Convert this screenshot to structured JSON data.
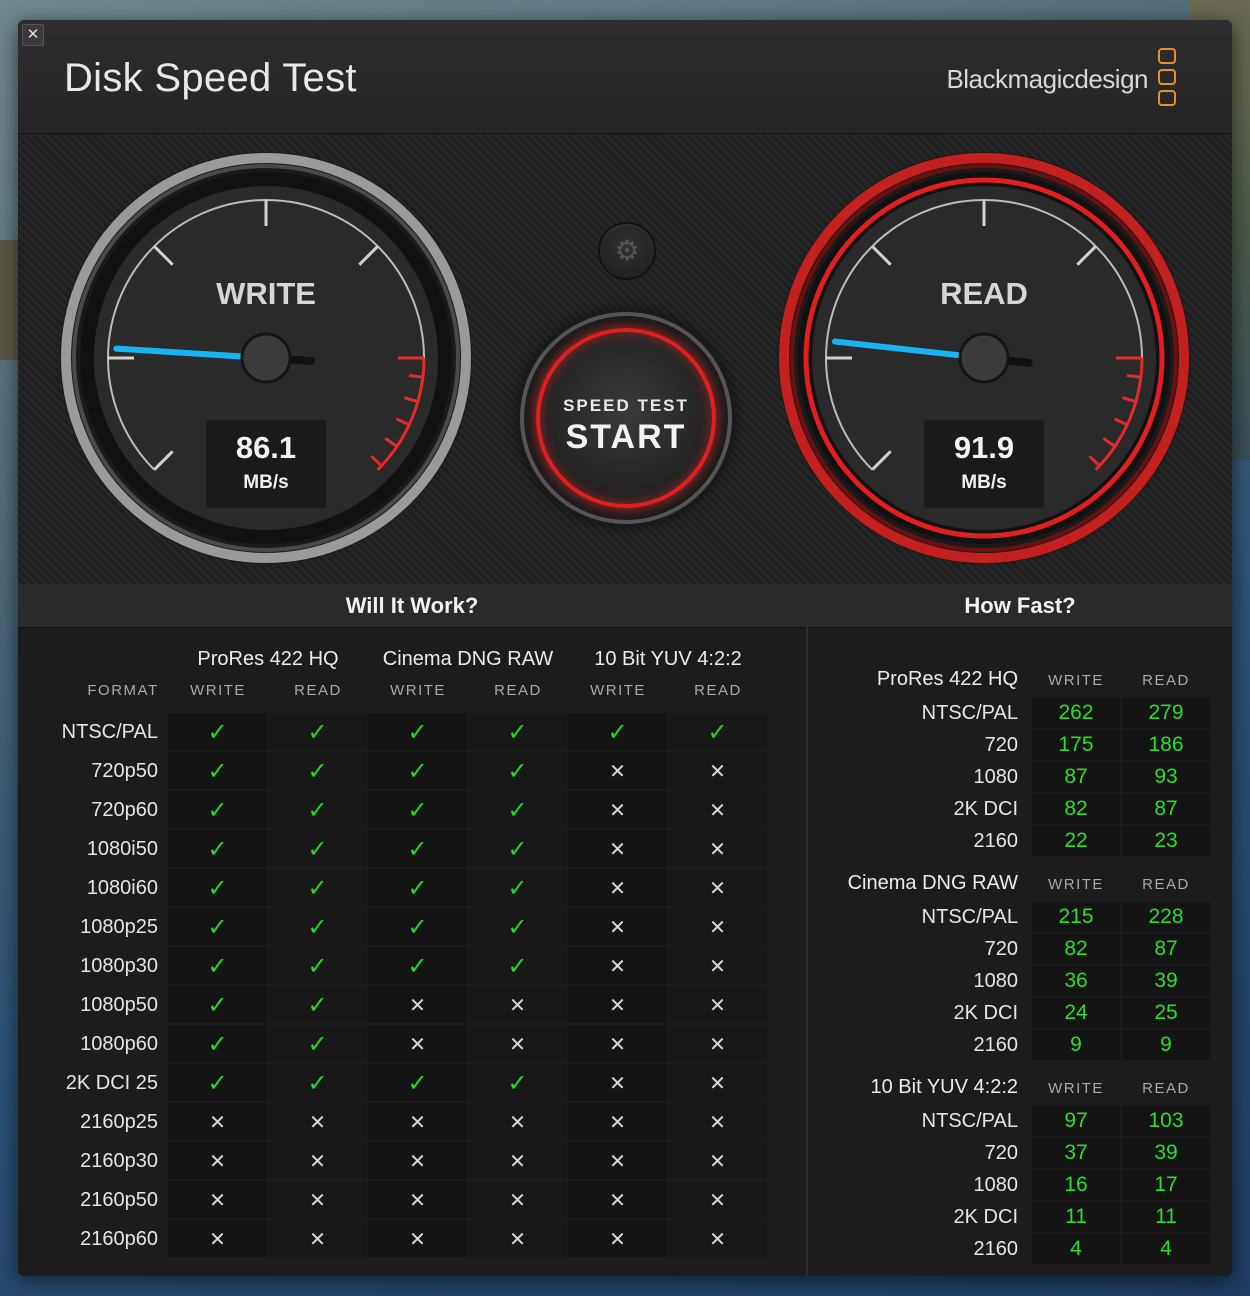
{
  "app": {
    "title": "Disk Speed Test",
    "brand": "Blackmagicdesign",
    "close_glyph": "✕",
    "accent_color": "#e11f1f",
    "ok_color": "#26d626"
  },
  "gauges": {
    "write": {
      "label": "WRITE",
      "value": "86.1",
      "unit": "MB/s",
      "fraction": 0.18
    },
    "read": {
      "label": "READ",
      "value": "91.9",
      "unit": "MB/s",
      "fraction": 0.19
    }
  },
  "controls": {
    "settings_icon": "gear-icon",
    "settings_glyph": "⚙",
    "start_small": "SPEED TEST",
    "start_big": "START"
  },
  "will_it_work": {
    "title": "Will It Work?",
    "format_label": "FORMAT",
    "groups": [
      {
        "name": "ProRes 422 HQ",
        "cols": [
          "WRITE",
          "READ"
        ]
      },
      {
        "name": "Cinema DNG RAW",
        "cols": [
          "WRITE",
          "READ"
        ]
      },
      {
        "name": "10 Bit YUV 4:2:2",
        "cols": [
          "WRITE",
          "READ"
        ]
      }
    ],
    "ok_glyph": "✓",
    "no_glyph": "✕",
    "rows": [
      {
        "format": "NTSC/PAL",
        "results": [
          1,
          1,
          1,
          1,
          1,
          1
        ]
      },
      {
        "format": "720p50",
        "results": [
          1,
          1,
          1,
          1,
          0,
          0
        ]
      },
      {
        "format": "720p60",
        "results": [
          1,
          1,
          1,
          1,
          0,
          0
        ]
      },
      {
        "format": "1080i50",
        "results": [
          1,
          1,
          1,
          1,
          0,
          0
        ]
      },
      {
        "format": "1080i60",
        "results": [
          1,
          1,
          1,
          1,
          0,
          0
        ]
      },
      {
        "format": "1080p25",
        "results": [
          1,
          1,
          1,
          1,
          0,
          0
        ]
      },
      {
        "format": "1080p30",
        "results": [
          1,
          1,
          1,
          1,
          0,
          0
        ]
      },
      {
        "format": "1080p50",
        "results": [
          1,
          1,
          0,
          0,
          0,
          0
        ]
      },
      {
        "format": "1080p60",
        "results": [
          1,
          1,
          0,
          0,
          0,
          0
        ]
      },
      {
        "format": "2K DCI 25",
        "results": [
          1,
          1,
          1,
          1,
          0,
          0
        ]
      },
      {
        "format": "2160p25",
        "results": [
          0,
          0,
          0,
          0,
          0,
          0
        ]
      },
      {
        "format": "2160p30",
        "results": [
          0,
          0,
          0,
          0,
          0,
          0
        ]
      },
      {
        "format": "2160p50",
        "results": [
          0,
          0,
          0,
          0,
          0,
          0
        ]
      },
      {
        "format": "2160p60",
        "results": [
          0,
          0,
          0,
          0,
          0,
          0
        ]
      }
    ]
  },
  "how_fast": {
    "title": "How Fast?",
    "write_label": "WRITE",
    "read_label": "READ",
    "blocks": [
      {
        "name": "ProRes 422 HQ",
        "rows": [
          {
            "format": "NTSC/PAL",
            "write": "262",
            "read": "279"
          },
          {
            "format": "720",
            "write": "175",
            "read": "186"
          },
          {
            "format": "1080",
            "write": "87",
            "read": "93"
          },
          {
            "format": "2K DCI",
            "write": "82",
            "read": "87"
          },
          {
            "format": "2160",
            "write": "22",
            "read": "23"
          }
        ]
      },
      {
        "name": "Cinema DNG RAW",
        "rows": [
          {
            "format": "NTSC/PAL",
            "write": "215",
            "read": "228"
          },
          {
            "format": "720",
            "write": "82",
            "read": "87"
          },
          {
            "format": "1080",
            "write": "36",
            "read": "39"
          },
          {
            "format": "2K DCI",
            "write": "24",
            "read": "25"
          },
          {
            "format": "2160",
            "write": "9",
            "read": "9"
          }
        ]
      },
      {
        "name": "10 Bit YUV 4:2:2",
        "rows": [
          {
            "format": "NTSC/PAL",
            "write": "97",
            "read": "103"
          },
          {
            "format": "720",
            "write": "37",
            "read": "39"
          },
          {
            "format": "1080",
            "write": "16",
            "read": "17"
          },
          {
            "format": "2K DCI",
            "write": "11",
            "read": "11"
          },
          {
            "format": "2160",
            "write": "4",
            "read": "4"
          }
        ]
      }
    ]
  }
}
